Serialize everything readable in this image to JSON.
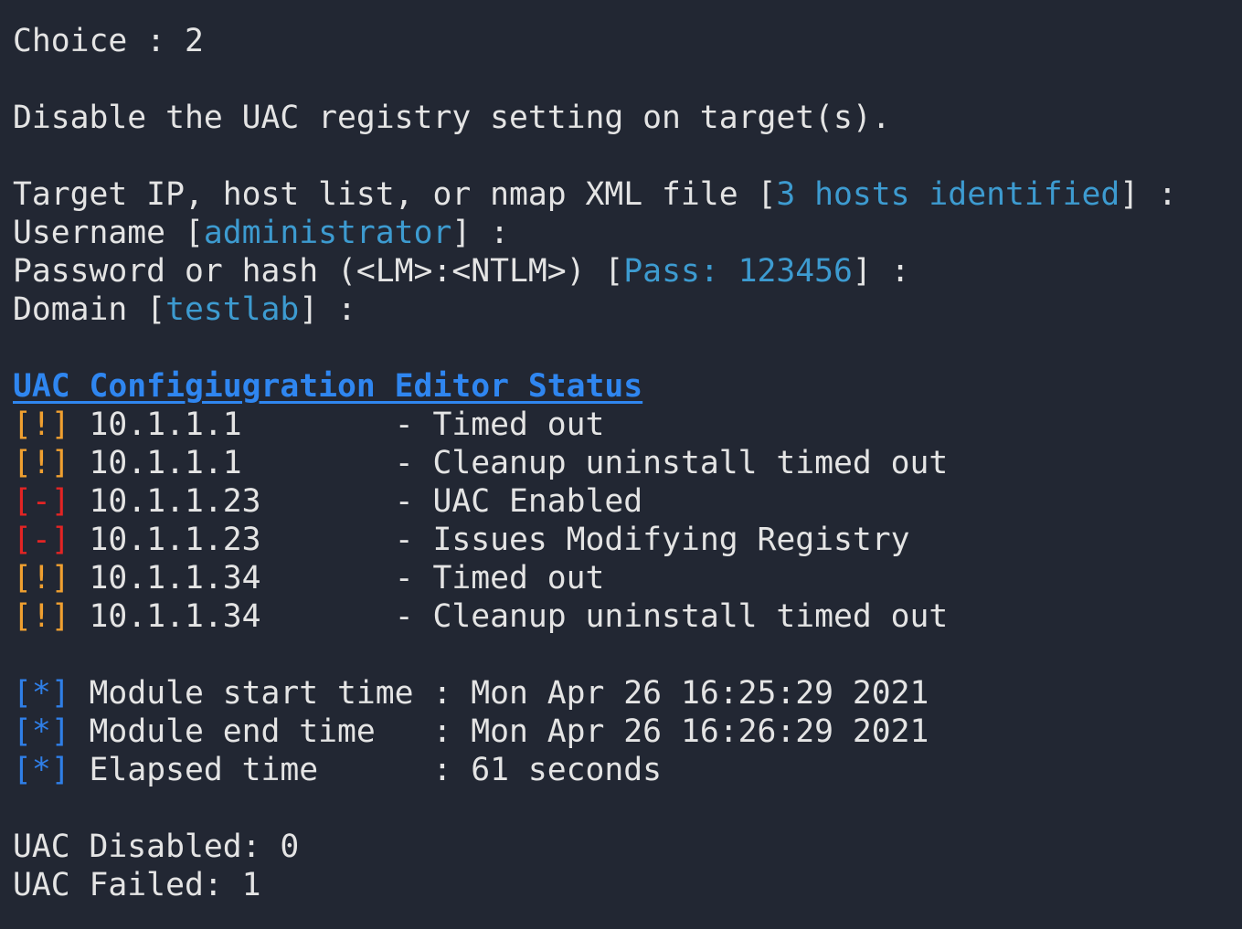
{
  "colors": {
    "background": "#222733",
    "text": "#e4e4e4",
    "highlight": "#3d9bd0",
    "header": "#2f86f0",
    "warning": "#f0a030",
    "error": "#e32424",
    "info": "#2f7fe8"
  },
  "choice": "Choice : 2",
  "description": "Disable the UAC registry setting on target(s).",
  "prompts": [
    {
      "label": "Target IP, host list, or nmap XML file ",
      "value": "3 hosts identified",
      "suffix": " :"
    },
    {
      "label": "Username ",
      "value": "administrator",
      "suffix": " :"
    },
    {
      "label": "Password or hash (<LM>:<NTLM>) ",
      "value": "Pass: 123456",
      "suffix": " :"
    },
    {
      "label": "Domain ",
      "value": "testlab",
      "suffix": " :"
    }
  ],
  "status_header": "UAC Configiugration Editor Status",
  "status_rows": [
    {
      "tag": "[!]",
      "type": "warning",
      "host": "10.1.1.1        ",
      "message": "- Timed out"
    },
    {
      "tag": "[!]",
      "type": "warning",
      "host": "10.1.1.1        ",
      "message": "- Cleanup uninstall timed out"
    },
    {
      "tag": "[-]",
      "type": "error",
      "host": "10.1.1.23       ",
      "message": "- UAC Enabled"
    },
    {
      "tag": "[-]",
      "type": "error",
      "host": "10.1.1.23       ",
      "message": "- Issues Modifying Registry"
    },
    {
      "tag": "[!]",
      "type": "warning",
      "host": "10.1.1.34       ",
      "message": "- Timed out"
    },
    {
      "tag": "[!]",
      "type": "warning",
      "host": "10.1.1.34       ",
      "message": "- Cleanup uninstall timed out"
    }
  ],
  "timing": [
    {
      "tag": "[*]",
      "text": "Module start time : Mon Apr 26 16:25:29 2021"
    },
    {
      "tag": "[*]",
      "text": "Module end time   : Mon Apr 26 16:26:29 2021"
    },
    {
      "tag": "[*]",
      "text": "Elapsed time      : 61 seconds"
    }
  ],
  "summary": [
    "UAC Disabled: 0",
    "UAC Failed: 1"
  ]
}
